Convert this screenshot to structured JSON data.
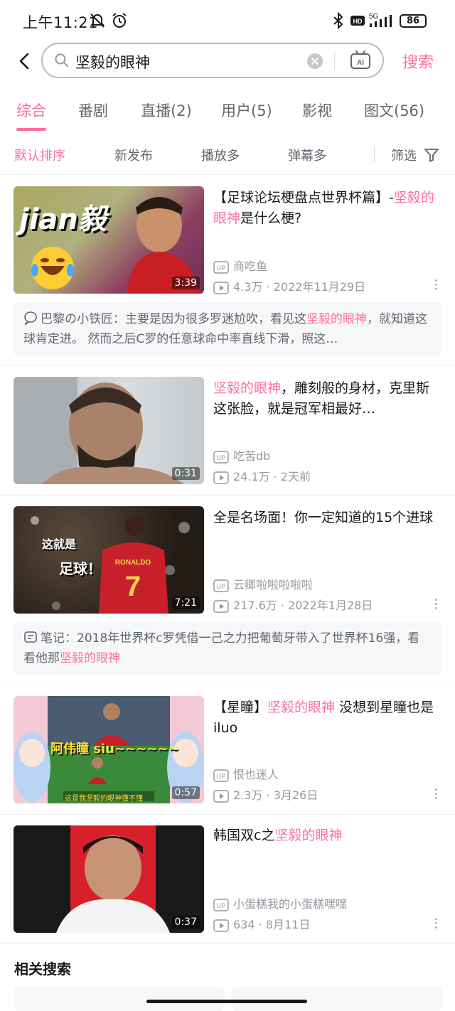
{
  "status": {
    "time": "上午11:21",
    "battery": "86",
    "network": "5G"
  },
  "search": {
    "query": "坚毅的眼神",
    "ai_label": "AI",
    "button": "搜索"
  },
  "tabs": [
    "综合",
    "番剧",
    "直播(2)",
    "用户(5)",
    "影视",
    "图文(56)"
  ],
  "sorts": [
    "默认排序",
    "新发布",
    "播放多",
    "弹幕多"
  ],
  "filter_label": "筛选",
  "videos": [
    {
      "title_pre": "【足球论坛梗盘点世界杯篇】-",
      "title_hl": "坚毅的眼神",
      "title_post": "是什么梗?",
      "thumb_text": "jian毅",
      "up": "商吃鱼",
      "stats": "4.3万 · 2022年11月29日",
      "duration": "3:39"
    },
    {
      "title_pre": "",
      "title_hl": "坚毅的眼神",
      "title_post": "，雕刻般的身材，克里斯这张脸，就是冠军相最好…",
      "up": "吃苦db",
      "stats": "24.1万 · 2天前",
      "duration": "0:31"
    },
    {
      "title_pre": "全是名场面！你一定知道的15个进球",
      "title_hl": "",
      "title_post": "",
      "thumb_text_1": "这就是",
      "thumb_text_2": "足球！",
      "jersey_name": "RONALDO",
      "jersey_number": "7",
      "up": "云卿啦啦啦啦啦",
      "stats": "217.6万 · 2022年1月28日",
      "duration": "7:21"
    },
    {
      "title_pre": "【星瞳】",
      "title_hl": "坚毅的眼神",
      "title_post": " 没想到星瞳也是iluo",
      "thumb_text": "阿伟瞳 siu~~~~~~",
      "thumb_caption": "这是我坚毅的眼神懂不懂",
      "up": "恨也迷人",
      "stats": "2.3万 · 3月26日",
      "duration": "0:57"
    },
    {
      "title_pre": "韩国双c之",
      "title_hl": "坚毅的眼神",
      "title_post": "",
      "up": "小蛋糕我的小蛋糕嘿嘿",
      "stats": "634 · 8月11日",
      "duration": "0:37"
    }
  ],
  "comment1": {
    "author": "巴黎の小铁匠：",
    "pre": "主要是因为很多罗迷尬吹，看见这",
    "hl": "坚毅的眼神",
    "post": "，就知道这球肯定进。 然而之后C罗的任意球命中率直线下滑，照这…"
  },
  "note3": {
    "author": "笔记：",
    "pre": "2018年世界杯c罗凭借一己之力把葡萄牙带入了世界杯16强，看看他那",
    "hl": "坚毅的眼神"
  },
  "related_title": "相关搜索",
  "colors": {
    "accent": "#fb7299",
    "text": "#18191c",
    "secondary": "#9499a0"
  }
}
